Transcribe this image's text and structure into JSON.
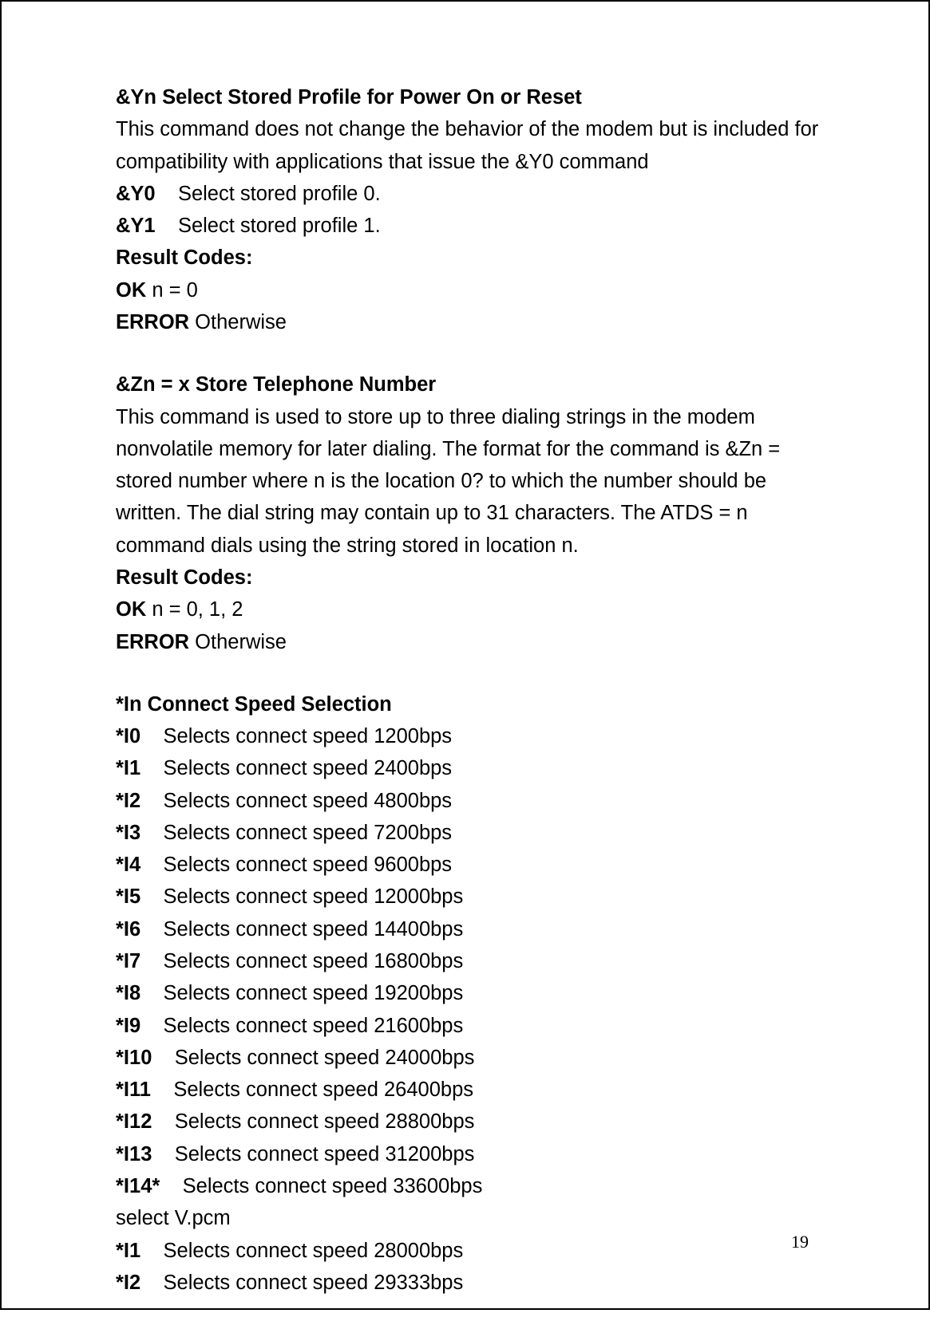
{
  "page_number": "19",
  "section1": {
    "heading": "&Yn Select Stored Profile for Power On or Reset",
    "desc": "This command does not change the behavior of the modem but is included for compatibility with applications that issue the &Y0 command",
    "opts": [
      {
        "cmd": "&Y0",
        "gap": "    ",
        "txt": "Select stored profile 0."
      },
      {
        "cmd": "&Y1",
        "gap": "    ",
        "txt": "Select stored profile 1."
      }
    ],
    "rc_label": "Result Codes:",
    "ok_label": "OK",
    "ok_val": " n = 0",
    "err_label": "ERROR",
    "err_val": " Otherwise"
  },
  "section2": {
    "heading": "&Zn = x Store Telephone Number",
    "desc": "This command is used to store up to three dialing strings in the modem nonvolatile memory for later dialing. The format for the command is &Zn = stored number where n is the location 0? to which the number should be written. The dial string may contain up to 31 characters. The ATDS = n command dials using the string stored in location n.",
    "rc_label": "Result Codes:",
    "ok_label": "OK",
    "ok_val": " n = 0, 1, 2",
    "err_label": "ERROR",
    "err_val": " Otherwise"
  },
  "section3": {
    "heading": "*In Connect Speed Selection",
    "opts": [
      {
        "cmd": "*I0",
        "gap": "    ",
        "txt": "Selects connect speed 1200bps"
      },
      {
        "cmd": "*I1",
        "gap": "    ",
        "txt": "Selects connect speed 2400bps"
      },
      {
        "cmd": "*I2",
        "gap": "    ",
        "txt": "Selects connect speed 4800bps"
      },
      {
        "cmd": "*I3",
        "gap": "    ",
        "txt": "Selects connect speed 7200bps"
      },
      {
        "cmd": "*I4",
        "gap": "    ",
        "txt": "Selects connect speed 9600bps"
      },
      {
        "cmd": "*I5",
        "gap": "    ",
        "txt": "Selects connect speed 12000bps"
      },
      {
        "cmd": "*I6",
        "gap": "    ",
        "txt": "Selects connect speed 14400bps"
      },
      {
        "cmd": "*I7",
        "gap": "    ",
        "txt": "Selects connect speed 16800bps"
      },
      {
        "cmd": "*I8",
        "gap": "    ",
        "txt": "Selects connect speed 19200bps"
      },
      {
        "cmd": "*I9",
        "gap": "    ",
        "txt": "Selects connect speed 21600bps"
      },
      {
        "cmd": "*I10",
        "gap": "    ",
        "txt": "Selects connect speed 24000bps"
      },
      {
        "cmd": "*I11",
        "gap": "    ",
        "txt": "Selects connect speed 26400bps"
      },
      {
        "cmd": "*I12",
        "gap": "    ",
        "txt": "Selects connect speed 28800bps"
      },
      {
        "cmd": "*I13",
        "gap": "    ",
        "txt": "Selects connect speed 31200bps"
      },
      {
        "cmd": "*I14*",
        "gap": "    ",
        "txt": "Selects connect speed 33600bps"
      }
    ],
    "note": "select V.pcm",
    "opts2": [
      {
        "cmd": "*I1",
        "gap": "    ",
        "txt": "Selects connect speed 28000bps"
      },
      {
        "cmd": "*I2",
        "gap": "    ",
        "txt": "Selects connect speed 29333bps"
      }
    ]
  }
}
